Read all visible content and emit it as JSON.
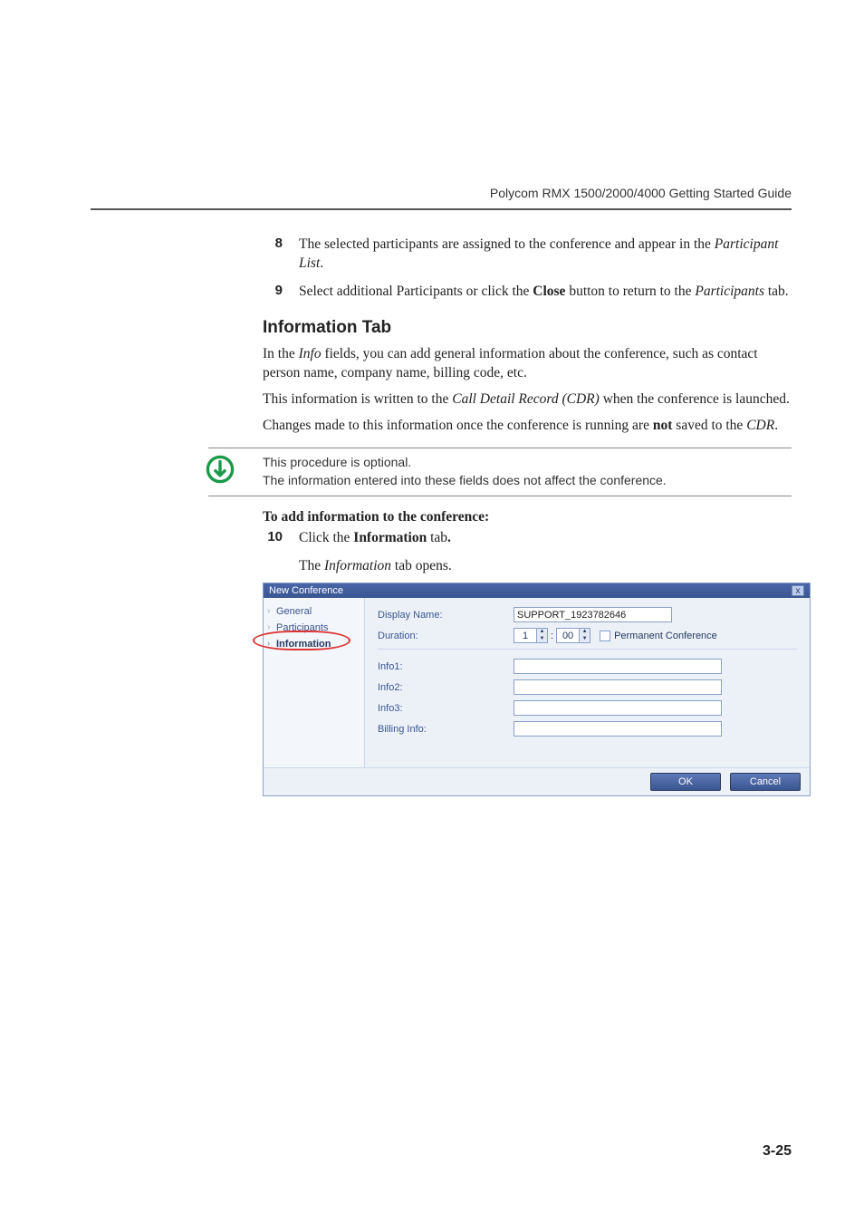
{
  "running_header": "Polycom RMX 1500/2000/4000 Getting Started Guide",
  "steps": {
    "s8": {
      "num": "8",
      "text_a": "The selected participants are assigned to the conference and appear in the ",
      "text_b": "Participant List",
      "text_c": "."
    },
    "s9": {
      "num": "9",
      "text_a": "Select additional Participants or click the ",
      "text_b": "Close",
      "text_c": " button to return to the ",
      "text_d": "Participants",
      "text_e": " tab."
    }
  },
  "section_heading": "Information Tab",
  "p1": {
    "a": "In the ",
    "b": "Info",
    "c": " fields, you can add general information about the conference, such as contact person name, company name, billing code, etc."
  },
  "p2": {
    "a": "This information is written to the ",
    "b": "Call Detail Record (CDR)",
    "c": " when the conference is launched."
  },
  "p3": {
    "a": "Changes made to this information once the conference is running are ",
    "b": "not",
    "c": " saved to the ",
    "d": "CDR",
    "e": "."
  },
  "note": {
    "line1": "This procedure is optional.",
    "line2": "The information entered into these fields does not affect the conference."
  },
  "proc_heading": "To add information to the conference:",
  "s10": {
    "num": "10",
    "a": "Click the ",
    "b": "Information",
    "c": " tab",
    "d": "."
  },
  "indent_line": {
    "a": "The ",
    "b": "Information",
    "c": " tab opens."
  },
  "dialog": {
    "title": "New Conference",
    "close_x": "x",
    "nav": {
      "general": "General",
      "participants": "Participants",
      "information": "Information"
    },
    "labels": {
      "display_name": "Display Name:",
      "duration": "Duration:",
      "info1": "Info1:",
      "info2": "Info2:",
      "info3": "Info3:",
      "billing": "Billing Info:"
    },
    "values": {
      "display_name": "SUPPORT_1923782646",
      "hours": "1",
      "colon": ":",
      "minutes": "00",
      "perm_conf": "Permanent Conference"
    },
    "buttons": {
      "ok": "OK",
      "cancel": "Cancel"
    }
  },
  "page_num": "3-25"
}
